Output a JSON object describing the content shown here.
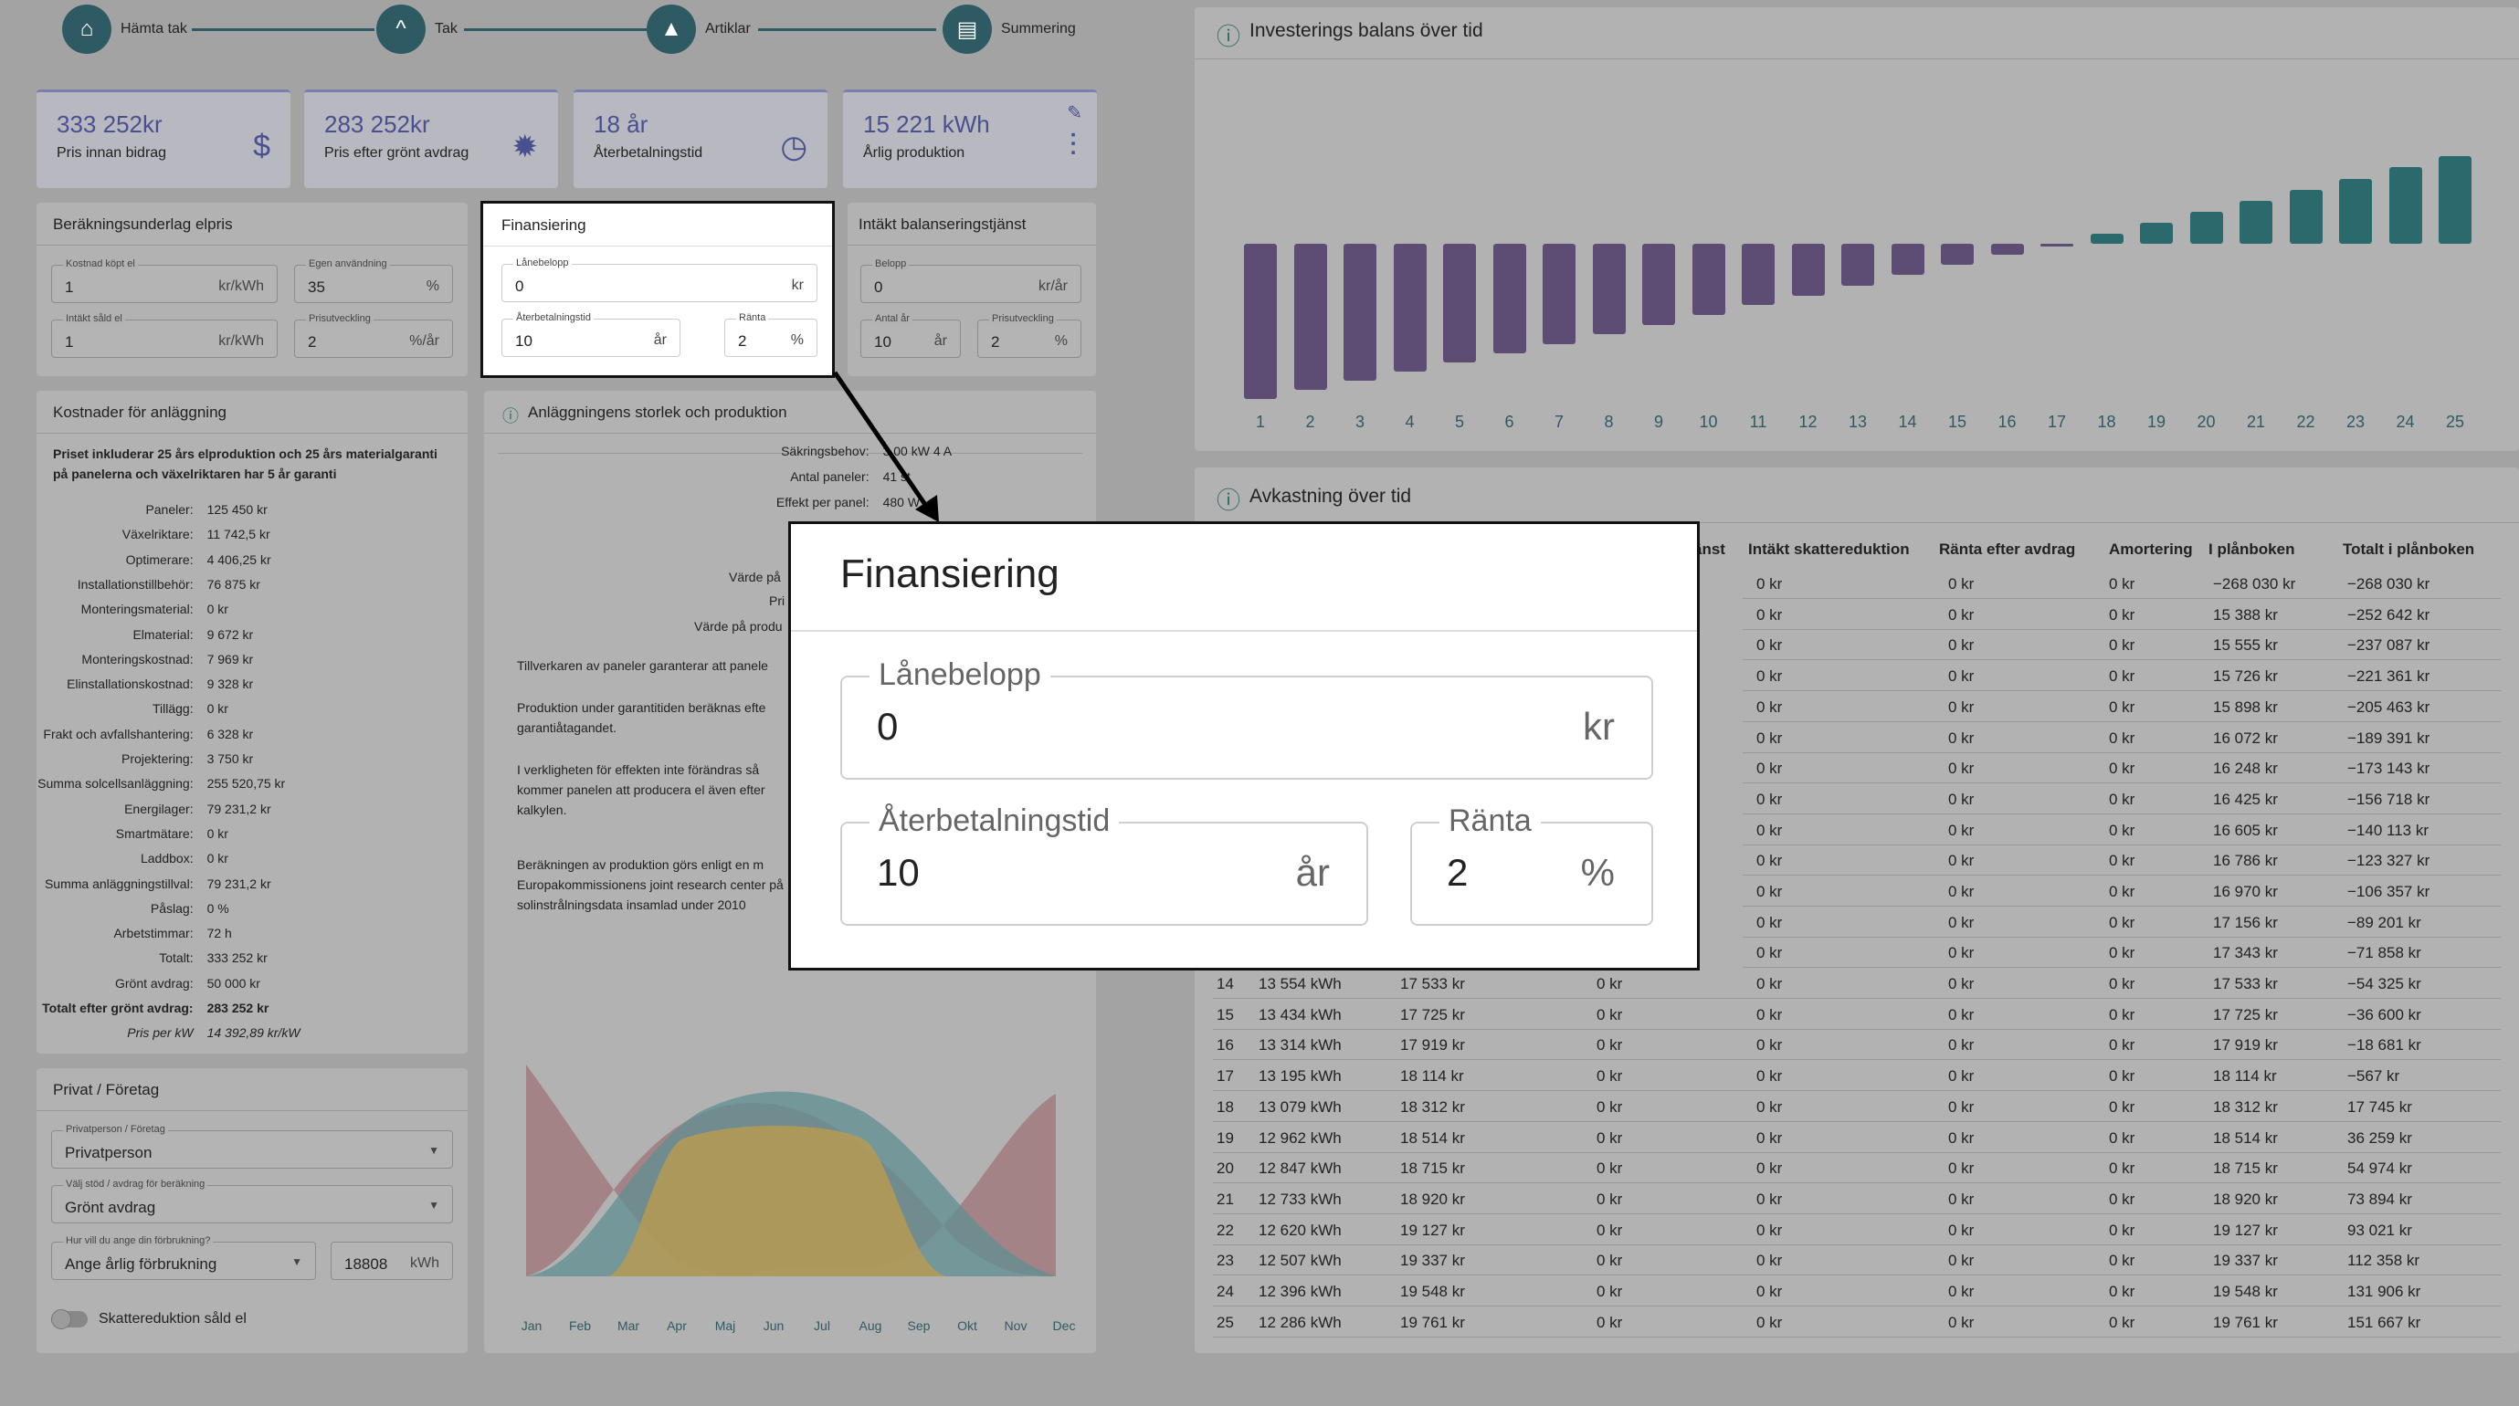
{
  "stepper": [
    {
      "label": "Hämta tak",
      "icon": "home-icon"
    },
    {
      "label": "Tak",
      "icon": "roof-icon"
    },
    {
      "label": "Artiklar",
      "icon": "shapes-icon"
    },
    {
      "label": "Summering",
      "icon": "document-icon"
    }
  ],
  "kpis": [
    {
      "value": "333 252kr",
      "label": "Pris innan bidrag",
      "icon": "dollar-icon"
    },
    {
      "value": "283 252kr",
      "label": "Pris efter grönt avdrag",
      "icon": "discount-badge-icon"
    },
    {
      "value": "18 år",
      "label": "Återbetalningstid",
      "icon": "history-clock-icon"
    },
    {
      "value": "15 221 kWh",
      "label": "Årlig produktion",
      "icon": "chart-growth-icon"
    }
  ],
  "calc": {
    "title": "Beräkningsunderlag elpris",
    "fields": [
      {
        "label": "Kostnad köpt el",
        "value": "1",
        "unit": "kr/kWh"
      },
      {
        "label": "Egen användning",
        "value": "35",
        "unit": "%"
      },
      {
        "label": "Intäkt såld el",
        "value": "1",
        "unit": "kr/kWh"
      },
      {
        "label": "Prisutveckling",
        "value": "2",
        "unit": "%/år"
      }
    ]
  },
  "financing": {
    "title": "Finansiering",
    "loan": {
      "label": "Lånebelopp",
      "value": "0",
      "unit": "kr"
    },
    "payback": {
      "label": "Återbetalningstid",
      "value": "10",
      "unit": "år"
    },
    "rate": {
      "label": "Ränta",
      "value": "2",
      "unit": "%"
    }
  },
  "balancing": {
    "title": "Intäkt balanseringstjänst",
    "amount": {
      "label": "Belopp",
      "value": "0",
      "unit": "kr/år"
    },
    "years": {
      "label": "Antal år",
      "value": "10",
      "unit": "år"
    },
    "trend": {
      "label": "Prisutveckling",
      "value": "2",
      "unit": "%"
    }
  },
  "costs": {
    "title": "Kostnader för anläggning",
    "note": "Priset inkluderar 25 års elproduktion och 25 års materialgaranti på panelerna och växelriktaren har 5 år garanti",
    "rows": [
      {
        "k": "Paneler:",
        "v": "125 450 kr"
      },
      {
        "k": "Växelriktare:",
        "v": "11 742,5 kr"
      },
      {
        "k": "Optimerare:",
        "v": "4 406,25 kr"
      },
      {
        "k": "Installationstillbehör:",
        "v": "76 875 kr"
      },
      {
        "k": "Monteringsmaterial:",
        "v": "0 kr"
      },
      {
        "k": "Elmaterial:",
        "v": "9 672 kr"
      },
      {
        "k": "Monteringskostnad:",
        "v": "7 969 kr"
      },
      {
        "k": "Elinstallationskostnad:",
        "v": "9 328 kr"
      },
      {
        "k": "Tillägg:",
        "v": "0 kr"
      },
      {
        "k": "Frakt och avfallshantering:",
        "v": "6 328 kr"
      },
      {
        "k": "Projektering:",
        "v": "3 750 kr"
      },
      {
        "k": "Summa solcellsanläggning:",
        "v": "255 520,75 kr"
      },
      {
        "k": "Energilager:",
        "v": "79 231,2 kr"
      },
      {
        "k": "Smartmätare:",
        "v": "0 kr"
      },
      {
        "k": "Laddbox:",
        "v": "0 kr"
      },
      {
        "k": "Summa anläggningstillval:",
        "v": "79 231,2 kr"
      },
      {
        "k": "Påslag:",
        "v": "0 %"
      },
      {
        "k": "Arbetstimmar:",
        "v": "72 h"
      },
      {
        "k": "Totalt:",
        "v": "333 252 kr"
      },
      {
        "k": "Grönt avdrag:",
        "v": "50 000 kr"
      },
      {
        "k": "Totalt efter grönt avdrag:",
        "v": "283 252 kr"
      },
      {
        "k": "Pris per kW",
        "v": "14 392,89 kr/kW"
      }
    ]
  },
  "plant": {
    "title": "Anläggningens storlek och produktion",
    "specs": [
      {
        "k": "Säkringsbehov:",
        "v": "3.00 kW 4 A"
      },
      {
        "k": "Antal paneler:",
        "v": "41 st"
      },
      {
        "k": "Effekt per panel:",
        "v": "480 W"
      }
    ],
    "values_partial": [
      "Värde på",
      "Pri",
      "Värde på produ"
    ],
    "texts": [
      "Tillverkaren av paneler garanterar att panele",
      "Produktion under garantitiden beräknas efte garantiåtagandet.",
      "I verkligheten för effekten inte förändras så kommer panelen att producera el även efter kalkylen.",
      "Beräkningen av produktion görs enligt en m Europakommissionens joint research center på solinstrålningsdata insamlad under 2010"
    ],
    "months": [
      "Jan",
      "Feb",
      "Mar",
      "Apr",
      "Maj",
      "Jun",
      "Jul",
      "Aug",
      "Sep",
      "Okt",
      "Nov",
      "Dec"
    ]
  },
  "privat": {
    "title": "Privat / Företag",
    "type": {
      "label": "Privatperson / Företag",
      "value": "Privatperson"
    },
    "support": {
      "label": "Välj stöd / avdrag för beräkning",
      "value": "Grönt avdrag"
    },
    "consumption": {
      "label": "Hur vill du ange din förbrukning?",
      "value": "Ange årlig förbrukning"
    },
    "kwh": {
      "value": "18808",
      "unit": "kWh"
    },
    "toggle_label": "Skattereduktion såld el"
  },
  "balance_chart": {
    "title": "Investerings balans över tid"
  },
  "chart_data": {
    "type": "bar",
    "categories": [
      "1",
      "2",
      "3",
      "4",
      "5",
      "6",
      "7",
      "8",
      "9",
      "10",
      "11",
      "12",
      "13",
      "14",
      "15",
      "16",
      "17",
      "18",
      "19",
      "20",
      "21",
      "22",
      "23",
      "24",
      "25"
    ],
    "values": [
      -268030,
      -252642,
      -237087,
      -221361,
      -205463,
      -189391,
      -173143,
      -156718,
      -140113,
      -123327,
      -106357,
      -89201,
      -71858,
      -54325,
      -36600,
      -18681,
      -567,
      17745,
      36259,
      54974,
      73894,
      93021,
      112358,
      131906,
      151667
    ]
  },
  "returns": {
    "title": "Avkastning över tid",
    "headers": [
      "änst",
      "Intäkt skattereduktion",
      "Ränta efter avdrag",
      "Amortering",
      "I plånboken",
      "Totalt i plånboken"
    ],
    "top_rows": [
      [
        "0 kr",
        "0 kr",
        "0 kr",
        "−268 030 kr",
        "−268 030 kr"
      ],
      [
        "0 kr",
        "0 kr",
        "0 kr",
        "15 388 kr",
        "−252 642 kr"
      ],
      [
        "0 kr",
        "0 kr",
        "0 kr",
        "15 555 kr",
        "−237 087 kr"
      ],
      [
        "0 kr",
        "0 kr",
        "0 kr",
        "15 726 kr",
        "−221 361 kr"
      ],
      [
        "0 kr",
        "0 kr",
        "0 kr",
        "15 898 kr",
        "−205 463 kr"
      ],
      [
        "0 kr",
        "0 kr",
        "0 kr",
        "16 072 kr",
        "−189 391 kr"
      ],
      [
        "0 kr",
        "0 kr",
        "0 kr",
        "16 248 kr",
        "−173 143 kr"
      ],
      [
        "0 kr",
        "0 kr",
        "0 kr",
        "16 425 kr",
        "−156 718 kr"
      ],
      [
        "0 kr",
        "0 kr",
        "0 kr",
        "16 605 kr",
        "−140 113 kr"
      ],
      [
        "0 kr",
        "0 kr",
        "0 kr",
        "16 786 kr",
        "−123 327 kr"
      ],
      [
        "0 kr",
        "0 kr",
        "0 kr",
        "16 970 kr",
        "−106 357 kr"
      ],
      [
        "0 kr",
        "0 kr",
        "0 kr",
        "17 156 kr",
        "−89 201 kr"
      ],
      [
        "0 kr",
        "0 kr",
        "0 kr",
        "17 343 kr",
        "−71 858 kr"
      ]
    ],
    "rows": [
      [
        "14",
        "13 554 kWh",
        "17 533 kr",
        "0 kr",
        "0 kr",
        "0 kr",
        "0 kr",
        "17 533 kr",
        "−54 325 kr"
      ],
      [
        "15",
        "13 434 kWh",
        "17 725 kr",
        "0 kr",
        "0 kr",
        "0 kr",
        "0 kr",
        "17 725 kr",
        "−36 600 kr"
      ],
      [
        "16",
        "13 314 kWh",
        "17 919 kr",
        "0 kr",
        "0 kr",
        "0 kr",
        "0 kr",
        "17 919 kr",
        "−18 681 kr"
      ],
      [
        "17",
        "13 195 kWh",
        "18 114 kr",
        "0 kr",
        "0 kr",
        "0 kr",
        "0 kr",
        "18 114 kr",
        "−567 kr"
      ],
      [
        "18",
        "13 079 kWh",
        "18 312 kr",
        "0 kr",
        "0 kr",
        "0 kr",
        "0 kr",
        "18 312 kr",
        "17 745 kr"
      ],
      [
        "19",
        "12 962 kWh",
        "18 514 kr",
        "0 kr",
        "0 kr",
        "0 kr",
        "0 kr",
        "18 514 kr",
        "36 259 kr"
      ],
      [
        "20",
        "12 847 kWh",
        "18 715 kr",
        "0 kr",
        "0 kr",
        "0 kr",
        "0 kr",
        "18 715 kr",
        "54 974 kr"
      ],
      [
        "21",
        "12 733 kWh",
        "18 920 kr",
        "0 kr",
        "0 kr",
        "0 kr",
        "0 kr",
        "18 920 kr",
        "73 894 kr"
      ],
      [
        "22",
        "12 620 kWh",
        "19 127 kr",
        "0 kr",
        "0 kr",
        "0 kr",
        "0 kr",
        "19 127 kr",
        "93 021 kr"
      ],
      [
        "23",
        "12 507 kWh",
        "19 337 kr",
        "0 kr",
        "0 kr",
        "0 kr",
        "0 kr",
        "19 337 kr",
        "112 358 kr"
      ],
      [
        "24",
        "12 396 kWh",
        "19 548 kr",
        "0 kr",
        "0 kr",
        "0 kr",
        "0 kr",
        "19 548 kr",
        "131 906 kr"
      ],
      [
        "25",
        "12 286 kWh",
        "19 761 kr",
        "0 kr",
        "0 kr",
        "0 kr",
        "0 kr",
        "19 761 kr",
        "151 667 kr"
      ]
    ]
  },
  "zoom": {
    "title": "Finansiering",
    "loan": {
      "label": "Lånebelopp",
      "value": "0",
      "unit": "kr"
    },
    "payback": {
      "label": "Återbetalningstid",
      "value": "10",
      "unit": "år"
    },
    "rate": {
      "label": "Ränta",
      "value": "2",
      "unit": "%"
    }
  }
}
